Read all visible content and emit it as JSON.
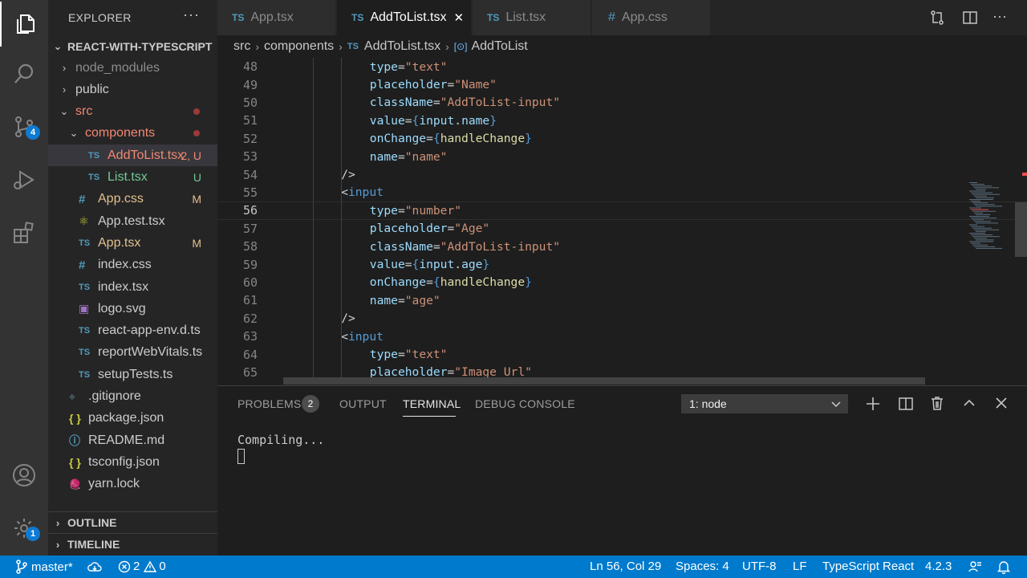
{
  "explorer": {
    "title": "EXPLORER",
    "more": "···",
    "root": "REACT-WITH-TYPESCRIPT",
    "items": [
      {
        "label": "node_modules",
        "kind": "folder",
        "open": false,
        "color": "#8c8c8c"
      },
      {
        "label": "public",
        "kind": "folder",
        "open": false,
        "color": "#cccccc"
      },
      {
        "label": "src",
        "kind": "folder",
        "open": true,
        "color": "#f48771"
      },
      {
        "label": "components",
        "kind": "folder",
        "open": true,
        "color": "#f48771"
      },
      {
        "label": "AddToList.tsx",
        "kind": "ts",
        "decoration": "2, U",
        "color": "#f48771"
      },
      {
        "label": "List.tsx",
        "kind": "ts",
        "decoration": "U",
        "color": "#73c991"
      },
      {
        "label": "App.css",
        "kind": "css",
        "decoration": "M",
        "color": "#e2c08d"
      },
      {
        "label": "App.test.tsx",
        "kind": "test",
        "color": "#cccccc"
      },
      {
        "label": "App.tsx",
        "kind": "ts",
        "decoration": "M",
        "color": "#e2c08d"
      },
      {
        "label": "index.css",
        "kind": "css",
        "color": "#cccccc"
      },
      {
        "label": "index.tsx",
        "kind": "ts",
        "color": "#cccccc"
      },
      {
        "label": "logo.svg",
        "kind": "svg",
        "color": "#cccccc"
      },
      {
        "label": "react-app-env.d.ts",
        "kind": "ts",
        "color": "#cccccc"
      },
      {
        "label": "reportWebVitals.ts",
        "kind": "ts",
        "color": "#cccccc"
      },
      {
        "label": "setupTests.ts",
        "kind": "ts",
        "color": "#cccccc"
      },
      {
        "label": ".gitignore",
        "kind": "git",
        "color": "#cccccc"
      },
      {
        "label": "package.json",
        "kind": "json",
        "color": "#cccccc"
      },
      {
        "label": "README.md",
        "kind": "md",
        "color": "#cccccc"
      },
      {
        "label": "tsconfig.json",
        "kind": "json",
        "color": "#cccccc"
      },
      {
        "label": "yarn.lock",
        "kind": "yarn",
        "color": "#cccccc"
      }
    ],
    "outline": "OUTLINE",
    "timeline": "TIMELINE"
  },
  "activity": {
    "scm_badge": "4",
    "manage_badge": "1"
  },
  "tabs": [
    {
      "label": "App.tsx",
      "icon": "TS"
    },
    {
      "label": "AddToList.tsx",
      "icon": "TS",
      "active": true,
      "close": "✕"
    },
    {
      "label": "List.tsx",
      "icon": "TS"
    },
    {
      "label": "App.css",
      "icon": "#"
    }
  ],
  "breadcrumb": {
    "parts": [
      "src",
      "components",
      "AddToList.tsx",
      "AddToList"
    ],
    "ts_icon": "TS",
    "sym_icon": "[⊙]"
  },
  "editor": {
    "lines": [
      {
        "n": "48",
        "indent": 12,
        "tokens": [
          [
            "attr",
            "type"
          ],
          [
            "punc",
            "="
          ],
          [
            "str",
            "\"text\""
          ]
        ]
      },
      {
        "n": "49",
        "indent": 12,
        "tokens": [
          [
            "attr",
            "placeholder"
          ],
          [
            "punc",
            "="
          ],
          [
            "str",
            "\"Name\""
          ]
        ]
      },
      {
        "n": "50",
        "indent": 12,
        "tokens": [
          [
            "attr",
            "className"
          ],
          [
            "punc",
            "="
          ],
          [
            "str",
            "\"AddToList-input\""
          ]
        ]
      },
      {
        "n": "51",
        "indent": 12,
        "tokens": [
          [
            "attr",
            "value"
          ],
          [
            "punc",
            "="
          ],
          [
            "brace",
            "{"
          ],
          [
            "attr",
            "input"
          ],
          [
            "punc",
            "."
          ],
          [
            "attr",
            "name"
          ],
          [
            "brace",
            "}"
          ]
        ]
      },
      {
        "n": "52",
        "indent": 12,
        "tokens": [
          [
            "attr",
            "onChange"
          ],
          [
            "punc",
            "="
          ],
          [
            "brace",
            "{"
          ],
          [
            "fn",
            "handleChange"
          ],
          [
            "brace",
            "}"
          ]
        ]
      },
      {
        "n": "53",
        "indent": 12,
        "tokens": [
          [
            "attr",
            "name"
          ],
          [
            "punc",
            "="
          ],
          [
            "str",
            "\"name\""
          ]
        ]
      },
      {
        "n": "54",
        "indent": 8,
        "tokens": [
          [
            "punc",
            "/>"
          ]
        ]
      },
      {
        "n": "55",
        "indent": 8,
        "tokens": [
          [
            "punc",
            "<"
          ],
          [
            "tag",
            "input"
          ]
        ]
      },
      {
        "n": "56",
        "indent": 12,
        "tokens": [
          [
            "attr",
            "type"
          ],
          [
            "punc",
            "="
          ],
          [
            "str",
            "\"number\""
          ]
        ],
        "current": true
      },
      {
        "n": "57",
        "indent": 12,
        "tokens": [
          [
            "attr",
            "placeholder"
          ],
          [
            "punc",
            "="
          ],
          [
            "str",
            "\"Age\""
          ]
        ]
      },
      {
        "n": "58",
        "indent": 12,
        "tokens": [
          [
            "attr",
            "className"
          ],
          [
            "punc",
            "="
          ],
          [
            "str",
            "\"AddToList-input\""
          ]
        ]
      },
      {
        "n": "59",
        "indent": 12,
        "tokens": [
          [
            "attr",
            "value"
          ],
          [
            "punc",
            "="
          ],
          [
            "brace",
            "{"
          ],
          [
            "attr",
            "input"
          ],
          [
            "punc",
            "."
          ],
          [
            "attr",
            "age"
          ],
          [
            "brace",
            "}"
          ]
        ]
      },
      {
        "n": "60",
        "indent": 12,
        "tokens": [
          [
            "attr",
            "onChange"
          ],
          [
            "punc",
            "="
          ],
          [
            "brace",
            "{"
          ],
          [
            "fn",
            "handleChange"
          ],
          [
            "brace",
            "}"
          ]
        ]
      },
      {
        "n": "61",
        "indent": 12,
        "tokens": [
          [
            "attr",
            "name"
          ],
          [
            "punc",
            "="
          ],
          [
            "str",
            "\"age\""
          ]
        ]
      },
      {
        "n": "62",
        "indent": 8,
        "tokens": [
          [
            "punc",
            "/>"
          ]
        ]
      },
      {
        "n": "63",
        "indent": 8,
        "tokens": [
          [
            "punc",
            "<"
          ],
          [
            "tag",
            "input"
          ]
        ]
      },
      {
        "n": "64",
        "indent": 12,
        "tokens": [
          [
            "attr",
            "type"
          ],
          [
            "punc",
            "="
          ],
          [
            "str",
            "\"text\""
          ]
        ]
      },
      {
        "n": "65",
        "indent": 12,
        "tokens": [
          [
            "attr",
            "placeholder"
          ],
          [
            "punc",
            "="
          ],
          [
            "str",
            "\"Image Url\""
          ]
        ]
      }
    ]
  },
  "panel": {
    "tabs": [
      "PROBLEMS",
      "OUTPUT",
      "TERMINAL",
      "DEBUG CONSOLE"
    ],
    "problems_count": "2",
    "terminal_select": "1: node",
    "terminal_output": "Compiling..."
  },
  "status": {
    "branch": "master*",
    "errors": "2",
    "warnings": "0",
    "position": "Ln 56, Col 29",
    "spaces": "Spaces: 4",
    "encoding": "UTF-8",
    "eol": "LF",
    "language": "TypeScript React",
    "version": "4.2.3"
  },
  "colors": {
    "accent": "#007acc",
    "badge": "#0e7ad3",
    "git_modified": "#e2c08d",
    "git_untracked": "#73c991",
    "git_error": "#f48771"
  }
}
